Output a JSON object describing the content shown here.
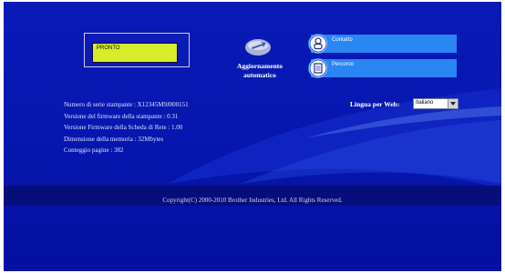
{
  "status": {
    "text": "PRONTO"
  },
  "update": {
    "label_line1": "Aggiornamento",
    "label_line2": "automatico"
  },
  "links": {
    "contact": "Contatto",
    "remote": "Percorso"
  },
  "info": {
    "serial": "Numero di serie stampante : X12345M9J000151",
    "printer_fw": "Versione del firmware della stampante : 0.31",
    "network_fw": "Versione Firmware della Scheda di Rete : 1.00",
    "memory": "Dimensione della memoria : 32Mbytes",
    "page_count": "Conteggio pagine : 382"
  },
  "language": {
    "label": "Lingua per Web:",
    "selected": "Italiano"
  },
  "footer": {
    "copyright": "Copyright(C) 2000-2010 Brother Industries, Ltd. All Rights Reserved."
  },
  "colors": {
    "background": "#0a1ab8",
    "lcd": "#d8ec2a",
    "link_bar": "#2a86f2"
  },
  "icons": {
    "update": "globe-arrow-icon",
    "contact": "person-icon",
    "remote": "document-icon"
  }
}
